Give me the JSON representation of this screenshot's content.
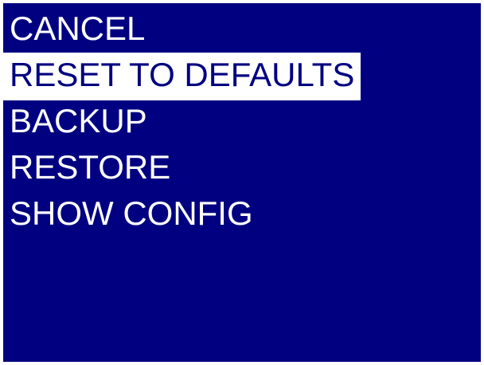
{
  "menu": {
    "items": [
      {
        "label": "CANCEL",
        "selected": false
      },
      {
        "label": "RESET TO DEFAULTS",
        "selected": true
      },
      {
        "label": "BACKUP",
        "selected": false
      },
      {
        "label": "RESTORE",
        "selected": false
      },
      {
        "label": "SHOW CONFIG",
        "selected": false
      }
    ]
  },
  "colors": {
    "screen_background": "#000080",
    "text": "#ffffff",
    "selection_background": "#ffffff",
    "selection_text": "#000080"
  }
}
